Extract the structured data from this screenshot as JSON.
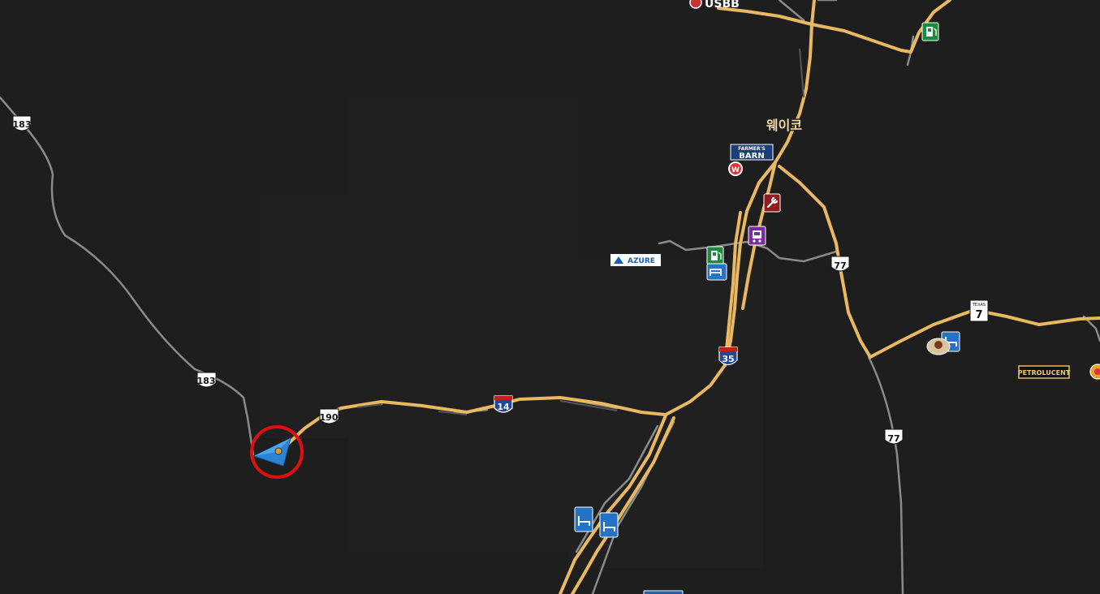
{
  "map": {
    "city_name": "웨이코",
    "top_label": "USBB",
    "route_shields": {
      "us183_north": "183",
      "us183_south": "183",
      "us190": "190",
      "i14": "14",
      "i35": "35",
      "us77_north": "77",
      "us77_south": "77",
      "tx7_state": "TEXAS",
      "tx7_number": "7"
    },
    "brands": {
      "farmers_barn_top": "FARMER'S",
      "farmers_barn_bottom": "BARN",
      "azure": "AZURE",
      "petrolucent": "PETROLUCENT",
      "wallbert": "W"
    },
    "colors": {
      "background": "#1e1e1e",
      "highway": "#e9b860",
      "minor_road": "#8a8a8a",
      "player_marker": "#2a84d6",
      "player_ring": "#e01010",
      "fuel_station": "#1e8a3c",
      "service": "#8e1d1d",
      "truck_dealer": "#7a2e9a",
      "rest_stop": "#2473c4"
    }
  }
}
